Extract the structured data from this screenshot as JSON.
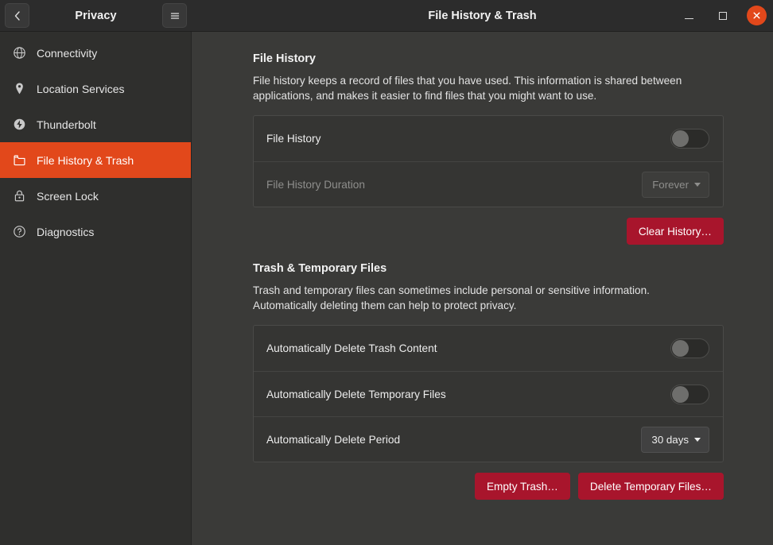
{
  "window": {
    "sidebar_title": "Privacy",
    "main_title": "File History & Trash",
    "back_icon": "chevron-left-icon",
    "menu_icon": "hamburger-menu-icon",
    "minimize_label": "Minimize",
    "maximize_label": "Maximize",
    "close_label": "Close",
    "accent_color": "#e2481b"
  },
  "sidebar": {
    "items": [
      {
        "label": "Connectivity",
        "icon": "globe-icon",
        "active": false
      },
      {
        "label": "Location Services",
        "icon": "location-pin-icon",
        "active": false
      },
      {
        "label": "Thunderbolt",
        "icon": "thunderbolt-icon",
        "active": false
      },
      {
        "label": "File History & Trash",
        "icon": "folder-icon",
        "active": true
      },
      {
        "label": "Screen Lock",
        "icon": "padlock-icon",
        "active": false
      },
      {
        "label": "Diagnostics",
        "icon": "question-circle-icon",
        "active": false
      }
    ]
  },
  "sections": [
    {
      "title": "File History",
      "description": "File history keeps a record of files that you have used. This information is shared between applications, and makes it easier to find files that you might want to use.",
      "rows": [
        {
          "label": "File History",
          "control": "switch",
          "state": "off",
          "dim": false
        },
        {
          "label": "File History Duration",
          "control": "dropdown",
          "value": "Forever",
          "dim": true
        }
      ],
      "buttons": [
        {
          "label": "Clear History…",
          "style": "danger"
        }
      ]
    },
    {
      "title": "Trash & Temporary Files",
      "description": "Trash and temporary files can sometimes include personal or sensitive information. Automatically deleting them can help to protect privacy.",
      "rows": [
        {
          "label": "Automatically Delete Trash Content",
          "control": "switch",
          "state": "off",
          "dim": false
        },
        {
          "label": "Automatically Delete Temporary Files",
          "control": "switch",
          "state": "off",
          "dim": false
        },
        {
          "label": "Automatically Delete Period",
          "control": "dropdown",
          "value": "30 days",
          "dim": false
        }
      ],
      "buttons": [
        {
          "label": "Empty Trash…",
          "style": "danger"
        },
        {
          "label": "Delete Temporary Files…",
          "style": "danger"
        }
      ]
    }
  ]
}
